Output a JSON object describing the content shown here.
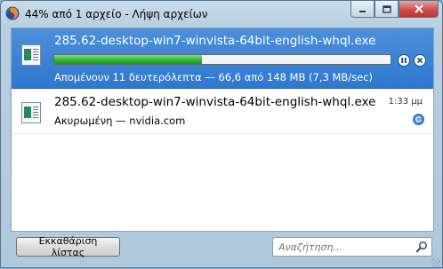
{
  "window": {
    "title": "44% από 1 αρχείο - Λήψη αρχείων",
    "app_icon": "firefox-icon",
    "controls": [
      "minimize-icon",
      "maximize-icon",
      "close-icon"
    ]
  },
  "downloads": [
    {
      "filename": "285.62-desktop-win7-winvista-64bit-english-whql.exe",
      "status": "Απομένουν 11 δευτερόλεπτα — 66,6 από 148 MB (7,3 MB/sec)",
      "progress_percent": 44,
      "state": "downloading",
      "icons": [
        "exe-file-icon",
        "pause-icon",
        "cancel-icon"
      ]
    },
    {
      "filename": "285.62-desktop-win7-winvista-64bit-english-whql.exe",
      "status": "Ακυρωμένη — nvidia.com",
      "time": "1:33 μμ",
      "state": "cancelled",
      "icons": [
        "exe-file-icon",
        "retry-icon"
      ]
    }
  ],
  "footer": {
    "clear_label": "Εκκαθάριση λίστας",
    "search_placeholder": "Αναζήτηση...",
    "search_icon": "search-icon"
  },
  "colors": {
    "selection": "#3a82d3",
    "progress_fill": "#2fb52a",
    "close_button": "#c75050"
  }
}
